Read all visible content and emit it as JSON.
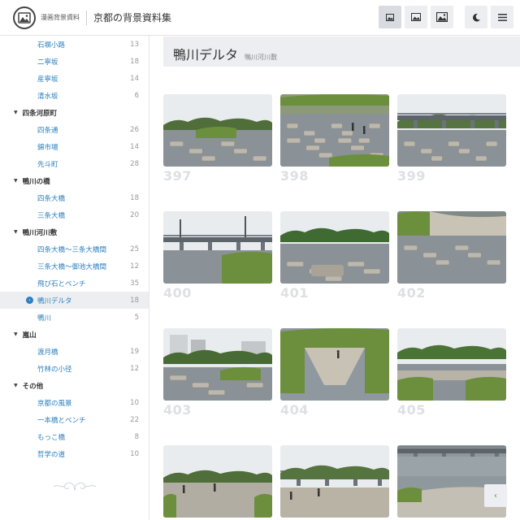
{
  "header": {
    "logo_text": "漫画背景資料",
    "site_title": "京都の背景資料集",
    "buttons": [
      "grid-small-icon",
      "grid-medium-icon",
      "grid-large-icon",
      "moon-icon",
      "menu-icon"
    ]
  },
  "sidebar": {
    "items": [
      {
        "type": "sub",
        "label": "石塀小路",
        "count": "13"
      },
      {
        "type": "sub",
        "label": "二寧坂",
        "count": "18"
      },
      {
        "type": "sub",
        "label": "産寧坂",
        "count": "14"
      },
      {
        "type": "sub",
        "label": "清水坂",
        "count": "6"
      },
      {
        "type": "cat",
        "label": "四条河原町"
      },
      {
        "type": "sub",
        "label": "四条通",
        "count": "26"
      },
      {
        "type": "sub",
        "label": "錦市場",
        "count": "14"
      },
      {
        "type": "sub",
        "label": "先斗町",
        "count": "28"
      },
      {
        "type": "cat",
        "label": "鴨川の橋"
      },
      {
        "type": "sub",
        "label": "四条大橋",
        "count": "18"
      },
      {
        "type": "sub",
        "label": "三条大橋",
        "count": "20"
      },
      {
        "type": "cat",
        "label": "鴨川河川敷"
      },
      {
        "type": "sub",
        "label": "四条大橋〜三条大橋間",
        "count": "25"
      },
      {
        "type": "sub",
        "label": "三条大橋〜御池大橋間",
        "count": "12"
      },
      {
        "type": "sub",
        "label": "飛び石とベンチ",
        "count": "35"
      },
      {
        "type": "sub",
        "label": "鴨川デルタ",
        "count": "18",
        "active": true
      },
      {
        "type": "sub",
        "label": "鴨川",
        "count": "5"
      },
      {
        "type": "cat",
        "label": "嵐山"
      },
      {
        "type": "sub",
        "label": "渡月橋",
        "count": "19"
      },
      {
        "type": "sub",
        "label": "竹林の小径",
        "count": "12"
      },
      {
        "type": "cat",
        "label": "その他"
      },
      {
        "type": "sub",
        "label": "京都の風景",
        "count": "10"
      },
      {
        "type": "sub",
        "label": "一本橋とベンチ",
        "count": "22"
      },
      {
        "type": "sub",
        "label": "もっこ橋",
        "count": "8"
      },
      {
        "type": "sub",
        "label": "哲学の道",
        "count": "10"
      }
    ]
  },
  "main": {
    "title": "鴨川デルタ",
    "subtitle": "鴨川河川敷",
    "photos": [
      {
        "num": "397",
        "scene": "stones-wide"
      },
      {
        "num": "398",
        "scene": "stones-people"
      },
      {
        "num": "399",
        "scene": "bridge-stones"
      },
      {
        "num": "400",
        "scene": "bridge-grass"
      },
      {
        "num": "401",
        "scene": "stones-trees"
      },
      {
        "num": "402",
        "scene": "stones-line"
      },
      {
        "num": "403",
        "scene": "town-stones"
      },
      {
        "num": "404",
        "scene": "delta-point"
      },
      {
        "num": "405",
        "scene": "river-grass"
      },
      {
        "num": "",
        "scene": "people-path"
      },
      {
        "num": "",
        "scene": "bridge-people"
      },
      {
        "num": "",
        "scene": "bridge-cobble"
      }
    ]
  },
  "colors": {
    "accent": "#2a7fbf",
    "panel": "#eceef2",
    "number": "#dde0e4"
  }
}
